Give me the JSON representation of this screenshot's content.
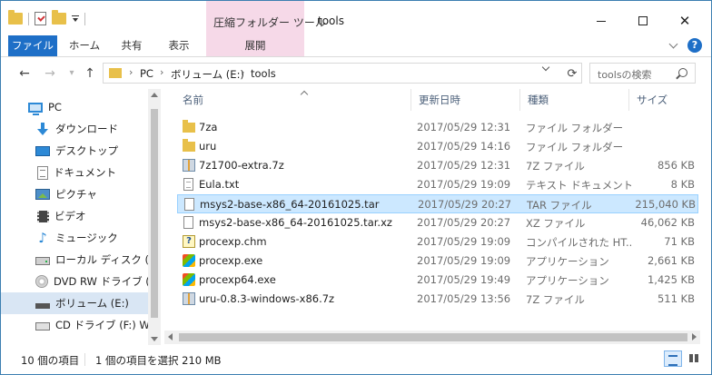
{
  "window": {
    "title": "tools",
    "context_tab_group": "圧縮フォルダー ツール"
  },
  "ribbon": {
    "tabs": [
      "ファイル",
      "ホーム",
      "共有",
      "表示"
    ],
    "context_tab": "展開"
  },
  "address": {
    "crumbs": [
      "PC",
      "ボリューム (E:)",
      "tools"
    ],
    "search_placeholder": "toolsの検索"
  },
  "nav_pane": {
    "items": [
      {
        "label": "PC",
        "icon": "pc-icon"
      },
      {
        "label": "ダウンロード",
        "icon": "download-icon"
      },
      {
        "label": "デスクトップ",
        "icon": "desktop-icon"
      },
      {
        "label": "ドキュメント",
        "icon": "document-icon"
      },
      {
        "label": "ピクチャ",
        "icon": "pictures-icon"
      },
      {
        "label": "ビデオ",
        "icon": "video-icon"
      },
      {
        "label": "ミュージック",
        "icon": "music-icon"
      },
      {
        "label": "ローカル ディスク (C:)",
        "icon": "drive-icon"
      },
      {
        "label": "DVD RW ドライブ (D:",
        "icon": "dvd-icon"
      },
      {
        "label": "ボリューム (E:)",
        "icon": "usb-drive-icon",
        "selected": true
      },
      {
        "label": "CD ドライブ (F:) WRE",
        "icon": "cd-drive-icon"
      }
    ]
  },
  "columns": {
    "name": "名前",
    "date": "更新日時",
    "type": "種類",
    "size": "サイズ"
  },
  "files": [
    {
      "name": "7za",
      "date": "2017/05/29 12:31",
      "type": "ファイル フォルダー",
      "size": "",
      "icon": "folder-icon"
    },
    {
      "name": "uru",
      "date": "2017/05/29 14:16",
      "type": "ファイル フォルダー",
      "size": "",
      "icon": "folder-icon"
    },
    {
      "name": "7z1700-extra.7z",
      "date": "2017/05/29 12:31",
      "type": "7Z ファイル",
      "size": "856 KB",
      "icon": "archive-icon"
    },
    {
      "name": "Eula.txt",
      "date": "2017/05/29 19:09",
      "type": "テキスト ドキュメント",
      "size": "8 KB",
      "icon": "text-file-icon"
    },
    {
      "name": "msys2-base-x86_64-20161025.tar",
      "date": "2017/05/29 20:27",
      "type": "TAR ファイル",
      "size": "215,040 KB",
      "icon": "file-icon",
      "selected": true
    },
    {
      "name": "msys2-base-x86_64-20161025.tar.xz",
      "date": "2017/05/29 20:27",
      "type": "XZ ファイル",
      "size": "46,062 KB",
      "icon": "file-icon"
    },
    {
      "name": "procexp.chm",
      "date": "2017/05/29 19:09",
      "type": "コンパイルされた HT...",
      "size": "71 KB",
      "icon": "help-file-icon"
    },
    {
      "name": "procexp.exe",
      "date": "2017/05/29 19:09",
      "type": "アプリケーション",
      "size": "2,661 KB",
      "icon": "exe-icon"
    },
    {
      "name": "procexp64.exe",
      "date": "2017/05/29 19:49",
      "type": "アプリケーション",
      "size": "1,425 KB",
      "icon": "exe-icon"
    },
    {
      "name": "uru-0.8.3-windows-x86.7z",
      "date": "2017/05/29 13:56",
      "type": "7Z ファイル",
      "size": "511 KB",
      "icon": "archive-icon"
    }
  ],
  "status": {
    "item_count": "10 個の項目",
    "selection": "1 個の項目を選択  210 MB"
  }
}
